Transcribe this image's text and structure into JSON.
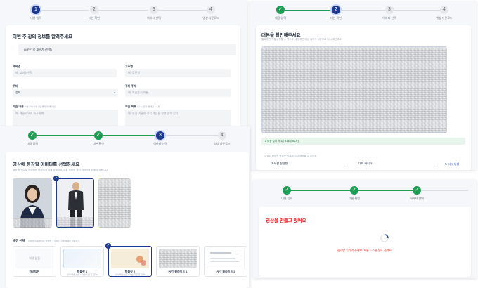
{
  "steps": [
    "내용 입력",
    "대본 확인",
    "아바타 선택",
    "영상 다운로드"
  ],
  "step_numbers": [
    "1",
    "2",
    "3",
    "4"
  ],
  "check_mark": "✓",
  "form": {
    "title": "이번 주 강의 정보를 알려주세요",
    "ppt_button": "PPT로 채우기 (선택)",
    "subject_label": "과목명",
    "subject_placeholder": "예: 교과실천학",
    "instructor_label": "교수명",
    "instructor_placeholder": "예: 김민정",
    "week_label": "주차",
    "week_value": "선택",
    "topic_label": "주차 주제",
    "topic_placeholder": "예: 학습동기 이론",
    "content_label": "학습 내용",
    "content_hint": "이번 주에 다룰 내용을 입력 해주세요",
    "content_placeholder": "예: 매슬로우의 욕구위계",
    "goal_label": "학습 목표",
    "goal_hint": "\"할 수 있다\" 형태로 1-3개",
    "goal_placeholder": "예: 동기 이론의 각각 개념을 설명할 수 있다"
  },
  "script": {
    "title": "대본을 확인해주세요",
    "subtitle": "필요하면 직접 수정할 수 있어요. 수정하면 예상 길이가 자동으로 다시 계산돼요",
    "status": "예상 길이 약 1분 51초 (562자)",
    "regen_hint": "수정된 원하면 원하는 목록에 다시 생성할 수 있어요",
    "tone_value": "자세한 설명형",
    "char_value": "대표 캐릭터",
    "regen_button": "다시 생성"
  },
  "avatar": {
    "title": "영상에 등장할 아바타를 선택하세요",
    "subtitle": "클릭 한 번으로 아바타와 목소리가 함께 정해져요. 하트 모양의 찜이 아바타의 위에 표시됩니다.",
    "avatar_names": [
      "",
      "",
      ""
    ],
    "bg_section": "배경 선택",
    "bg_hint": "아바타 뒤에 보이는 배경을 고르세요. 기본 배경이 적용돼요",
    "backgrounds": [
      {
        "name": "아바타만",
        "desc": "",
        "thumb_text": "배경 없음"
      },
      {
        "name": "템플릿 1",
        "desc": "강의/학습 반응 / 학습 지원 중 공부/"
      },
      {
        "name": "템플릿 2",
        "desc": "강의/학습 반응 / 학습 지원 중 공부/"
      },
      {
        "name": "PPT 슬라이드 1",
        "desc": ""
      },
      {
        "name": "PPT 슬라이드 2",
        "desc": ""
      }
    ]
  },
  "progress": {
    "title": "영상을 만들고 있어요",
    "message": "잠시만 기다려 주세요. 보통 1~2분 정도 걸려요."
  },
  "colors": {
    "accent": "#1e3a8a",
    "done": "#1f9d55",
    "error": "#dc2626"
  }
}
